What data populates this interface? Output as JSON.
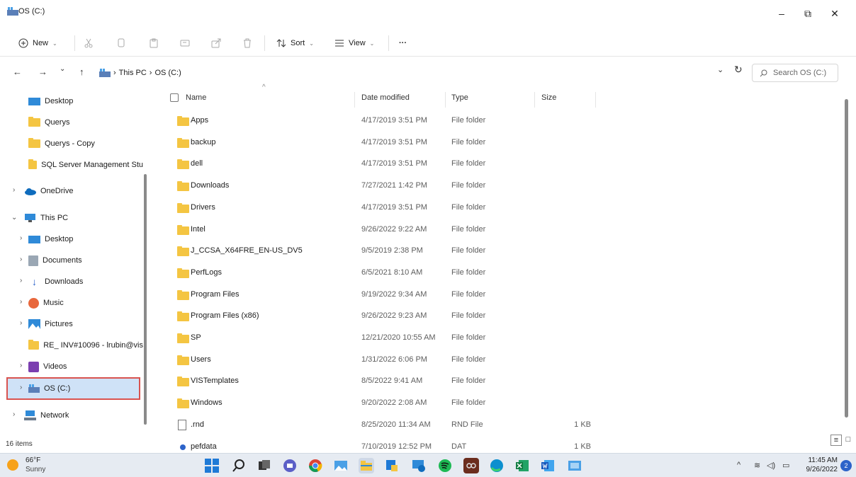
{
  "window": {
    "title": "OS (C:)",
    "minimize": "–",
    "maximize": "⧉",
    "close": "✕"
  },
  "toolbar": {
    "new_label": "New",
    "sort_label": "Sort",
    "view_label": "View",
    "more_label": "···"
  },
  "address": {
    "back": "←",
    "forward": "→",
    "recent": "⌄",
    "up": "↑",
    "crumbs": [
      "This PC",
      "OS (C:)"
    ],
    "separator": "›",
    "dropdown": "⌄",
    "refresh": "↻",
    "search_placeholder": "Search OS (C:)"
  },
  "sidebar": {
    "items": [
      {
        "label": "Desktop",
        "icon": "desktop-icon"
      },
      {
        "label": "Querys",
        "icon": "folder-icon"
      },
      {
        "label": "Querys - Copy",
        "icon": "folder-icon"
      },
      {
        "label": "SQL Server Management Stu",
        "icon": "folder-icon"
      },
      {
        "label": "OneDrive",
        "icon": "onedrive-icon"
      },
      {
        "label": "This PC",
        "icon": "this-pc-icon"
      },
      {
        "label": "Desktop",
        "icon": "desktop-icon"
      },
      {
        "label": "Documents",
        "icon": "documents-icon"
      },
      {
        "label": "Downloads",
        "icon": "downloads-icon"
      },
      {
        "label": "Music",
        "icon": "music-icon"
      },
      {
        "label": "Pictures",
        "icon": "pictures-icon"
      },
      {
        "label": "RE_ INV#10096 - lrubin@vis",
        "icon": "folder-icon"
      },
      {
        "label": "Videos",
        "icon": "videos-icon"
      },
      {
        "label": "OS (C:)",
        "icon": "drive-icon"
      },
      {
        "label": "Network",
        "icon": "network-icon"
      }
    ]
  },
  "columns": {
    "name": "Name",
    "date": "Date modified",
    "type": "Type",
    "size": "Size"
  },
  "files": [
    {
      "name": "Apps",
      "date": "4/17/2019 3:51 PM",
      "type": "File folder",
      "size": ""
    },
    {
      "name": "backup",
      "date": "4/17/2019 3:51 PM",
      "type": "File folder",
      "size": ""
    },
    {
      "name": "dell",
      "date": "4/17/2019 3:51 PM",
      "type": "File folder",
      "size": ""
    },
    {
      "name": "Downloads",
      "date": "7/27/2021 1:42 PM",
      "type": "File folder",
      "size": ""
    },
    {
      "name": "Drivers",
      "date": "4/17/2019 3:51 PM",
      "type": "File folder",
      "size": ""
    },
    {
      "name": "Intel",
      "date": "9/26/2022 9:22 AM",
      "type": "File folder",
      "size": ""
    },
    {
      "name": "J_CCSA_X64FRE_EN-US_DV5",
      "date": "9/5/2019 2:38 PM",
      "type": "File folder",
      "size": ""
    },
    {
      "name": "PerfLogs",
      "date": "6/5/2021 8:10 AM",
      "type": "File folder",
      "size": ""
    },
    {
      "name": "Program Files",
      "date": "9/19/2022 9:34 AM",
      "type": "File folder",
      "size": ""
    },
    {
      "name": "Program Files (x86)",
      "date": "9/26/2022 9:23 AM",
      "type": "File folder",
      "size": ""
    },
    {
      "name": "SP",
      "date": "12/21/2020 10:55 AM",
      "type": "File folder",
      "size": ""
    },
    {
      "name": "Users",
      "date": "1/31/2022 6:06 PM",
      "type": "File folder",
      "size": ""
    },
    {
      "name": "VISTemplates",
      "date": "8/5/2022 9:41 AM",
      "type": "File folder",
      "size": ""
    },
    {
      "name": "Windows",
      "date": "9/20/2022 2:08 AM",
      "type": "File folder",
      "size": ""
    },
    {
      "name": ".rnd",
      "date": "8/25/2020 11:34 AM",
      "type": "RND File",
      "size": "1 KB"
    },
    {
      "name": "pefdata",
      "date": "7/10/2019 12:52 PM",
      "type": "DAT",
      "size": "1 KB"
    }
  ],
  "status": {
    "item_count": "16 items"
  },
  "taskbar": {
    "temperature": "66°F",
    "condition": "Sunny",
    "time": "11:45 AM",
    "date": "9/26/2022",
    "notifications": "2"
  },
  "colors": {
    "folder": "#f4c542",
    "accent": "#2c63c9",
    "selection": "#cfe2f7",
    "highlight_border": "#d9534f"
  }
}
